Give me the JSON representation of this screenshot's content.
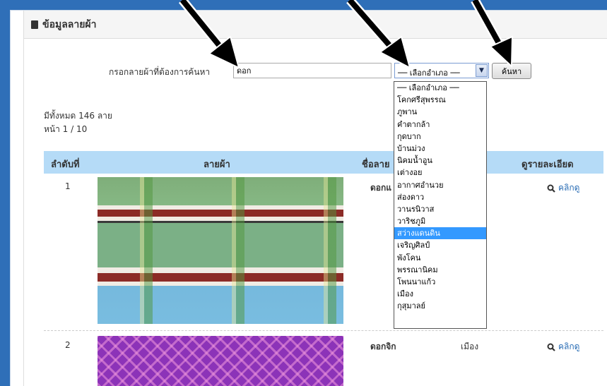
{
  "panel": {
    "title": "ข้อมูลลายผ้า"
  },
  "search": {
    "label": "กรอกลายผ้าที่ต้องการค้นหา",
    "value": "ดอก",
    "district_selected": "── เลือกอำเภอ ──",
    "button": "ค้นหา"
  },
  "summary": {
    "total": "มีทั้งหมด 146 ลาย",
    "page": "หน้า 1 / 10"
  },
  "table": {
    "headers": [
      "ลำดับที่",
      "ลายผ้า",
      "ชื่อลาย",
      "ดูรายละเอียด"
    ],
    "rows": [
      {
        "num": "1",
        "name": "ดอกแ",
        "district": "",
        "detail": "คลิกดู"
      },
      {
        "num": "2",
        "name": "ดอกจิก",
        "district": "เมือง",
        "detail": "คลิกดู"
      }
    ]
  },
  "dropdown": {
    "options": [
      "── เลือกอำเภอ ──",
      "โคกศรีสุพรรณ",
      "ภูพาน",
      "คำตากล้า",
      "กุดบาก",
      "บ้านม่วง",
      "นิคมน้ำอูน",
      "เต่างอย",
      "อากาศอำนวย",
      "ส่องดาว",
      "วานรนิวาส",
      "วาริชภูมิ",
      "สว่างแดนดิน",
      "เจริญศิลป์",
      "พังโคน",
      "พรรณานิคม",
      "โพนนาแก้ว",
      "เมือง",
      "กุสุมาลย์"
    ],
    "highlighted_index": 12
  },
  "colors": {
    "table_header": "#b5dbf7",
    "link": "#2a6db5",
    "highlight": "#3399ff",
    "frame": "#2f6fb8"
  },
  "icons": {
    "panel": "book-icon",
    "detail": "magnifier-icon",
    "select": "chevron-down-icon"
  }
}
